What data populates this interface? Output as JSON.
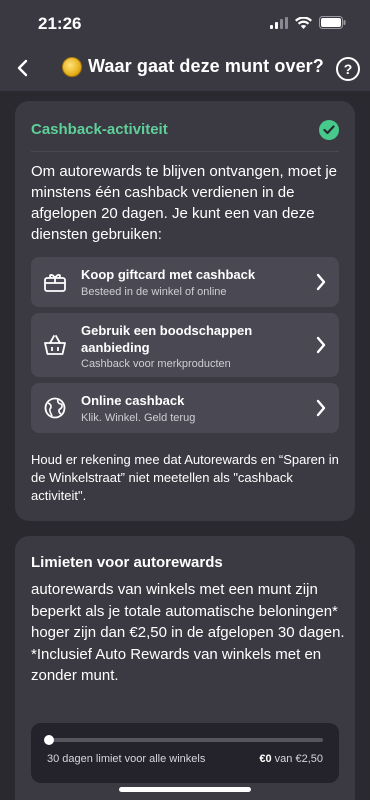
{
  "status_bar": {
    "time": "21:26"
  },
  "header": {
    "title": "Waar gaat deze munt over?"
  },
  "cashback_card": {
    "title": "Cashback-activiteit",
    "intro": "Om autorewards te blijven ontvangen, moet je minstens één cashback verdienen in de afgelopen 20 dagen. Je kunt een van deze diensten gebruiken:",
    "services": [
      {
        "title": "Koop giftcard met cashback",
        "subtitle": "Besteed in de winkel of online",
        "icon": "gift-card-icon"
      },
      {
        "title": "Gebruik een boodschappen aanbieding",
        "subtitle": "Cashback voor merkproducten",
        "icon": "basket-icon"
      },
      {
        "title": "Online cashback",
        "subtitle": "Klik. Winkel. Geld terug",
        "icon": "globe-icon"
      }
    ],
    "note": "Houd er rekening mee dat Autorewards en “Sparen in de Winkelstraat” niet meetellen als \"cashback activiteit\"."
  },
  "limits_card": {
    "title": "Limieten voor autorewards",
    "text": "autorewards van winkels met een munt zijn beperkt als je totale automatische beloningen* hoger zijn dan €2,50 in de afgelopen 30 dagen.\n*Inclusief Auto Rewards van winkels met en zonder munt.",
    "limit_label": "30 dagen limiet voor alle winkels",
    "current_amount": "€0",
    "amount_separator": "van",
    "limit_amount": "€2,50",
    "progress": 0
  },
  "colors": {
    "accent_green": "#5ed09a",
    "check_green": "#46c98a",
    "card_bg": "#3b3941",
    "page_bg": "#2b2930"
  }
}
